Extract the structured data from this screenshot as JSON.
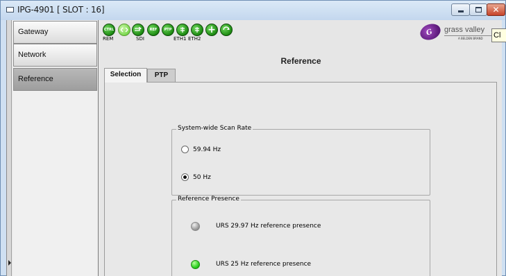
{
  "window": {
    "title": "IPG-4901 [ SLOT : 16]"
  },
  "sidebar": {
    "items": [
      {
        "label": "Gateway",
        "active": false
      },
      {
        "label": "Network",
        "active": false
      },
      {
        "label": "Reference",
        "active": true
      }
    ]
  },
  "toolbar": {
    "icons": [
      {
        "name": "ctrl-icon",
        "text": "CTRL",
        "label": "REM"
      },
      {
        "name": "sdi-link-icon",
        "text": "",
        "label": ""
      },
      {
        "name": "sdi-icon",
        "text": "",
        "label": "SDI"
      },
      {
        "name": "ref-icon",
        "text": "REF",
        "label": ""
      },
      {
        "name": "ptp-icon",
        "text": "PTP",
        "label": ""
      },
      {
        "name": "eth1-icon",
        "text": "",
        "label": "ETH1"
      },
      {
        "name": "eth2-icon",
        "text": "",
        "label": "ETH2"
      },
      {
        "name": "add-icon",
        "text": "",
        "label": ""
      },
      {
        "name": "sync-icon",
        "text": "",
        "label": ""
      }
    ],
    "brand": {
      "name": "grass valley",
      "sub": "A BELDEN BRAND"
    },
    "tooltip_fragment": "Cl"
  },
  "page": {
    "heading": "Reference",
    "tabs": [
      {
        "label": "Selection",
        "active": true
      },
      {
        "label": "PTP",
        "active": false
      }
    ]
  },
  "scan_rate": {
    "title": "System-wide Scan Rate",
    "options": [
      {
        "label": "59.94 Hz",
        "selected": false
      },
      {
        "label": "50 Hz",
        "selected": true
      }
    ]
  },
  "reference_presence": {
    "title": "Reference Presence",
    "items": [
      {
        "label": "URS 29.97 Hz reference presence",
        "state": "off"
      },
      {
        "label": "URS 25 Hz reference presence",
        "state": "on"
      }
    ]
  }
}
